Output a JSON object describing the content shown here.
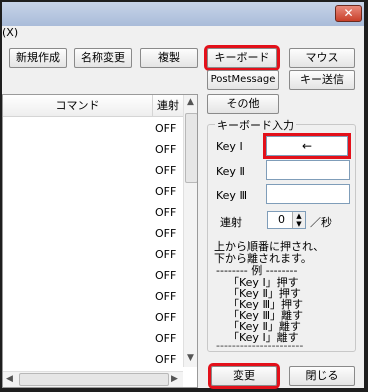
{
  "window": {
    "menu_fragment": "(X)",
    "close_glyph": "✕"
  },
  "toolbar": {
    "new_label": "新規作成",
    "rename_label": "名称変更",
    "duplicate_label": "複製",
    "keyboard_label": "キーボード",
    "mouse_label": "マウス",
    "postmessage_label": "PostMessage",
    "keysend_label": "キー送信",
    "other_label": "その他"
  },
  "list": {
    "columns": [
      "コマンド",
      "連射"
    ],
    "rows": [
      "OFF",
      "OFF",
      "OFF",
      "OFF",
      "OFF",
      "OFF",
      "OFF",
      "OFF",
      "OFF",
      "OFF",
      "OFF",
      "OFF"
    ]
  },
  "keyboard_input": {
    "title": "キーボード入力",
    "key1_label": "Key Ⅰ",
    "key1_value": "←",
    "key2_label": "Key Ⅱ",
    "key2_value": "",
    "key3_label": "Key Ⅲ",
    "key3_value": "",
    "rate_label": "連射",
    "rate_value": "0",
    "rate_unit": "／秒",
    "desc_line1": "上から順番に押され、",
    "desc_line2": "下から離されます。",
    "example_header": "-------- 例 --------",
    "example_lines": [
      "「Key Ⅰ」押す",
      "「Key Ⅱ」押す",
      "「Key Ⅲ」押す",
      "「Key Ⅲ」離す",
      "「Key Ⅱ」離す",
      "「Key Ⅰ」離す"
    ],
    "footer_line": "----------------------"
  },
  "footer": {
    "change_label": "変更",
    "close_label": "閉じる"
  },
  "colors": {
    "highlight": "#e3101a"
  }
}
